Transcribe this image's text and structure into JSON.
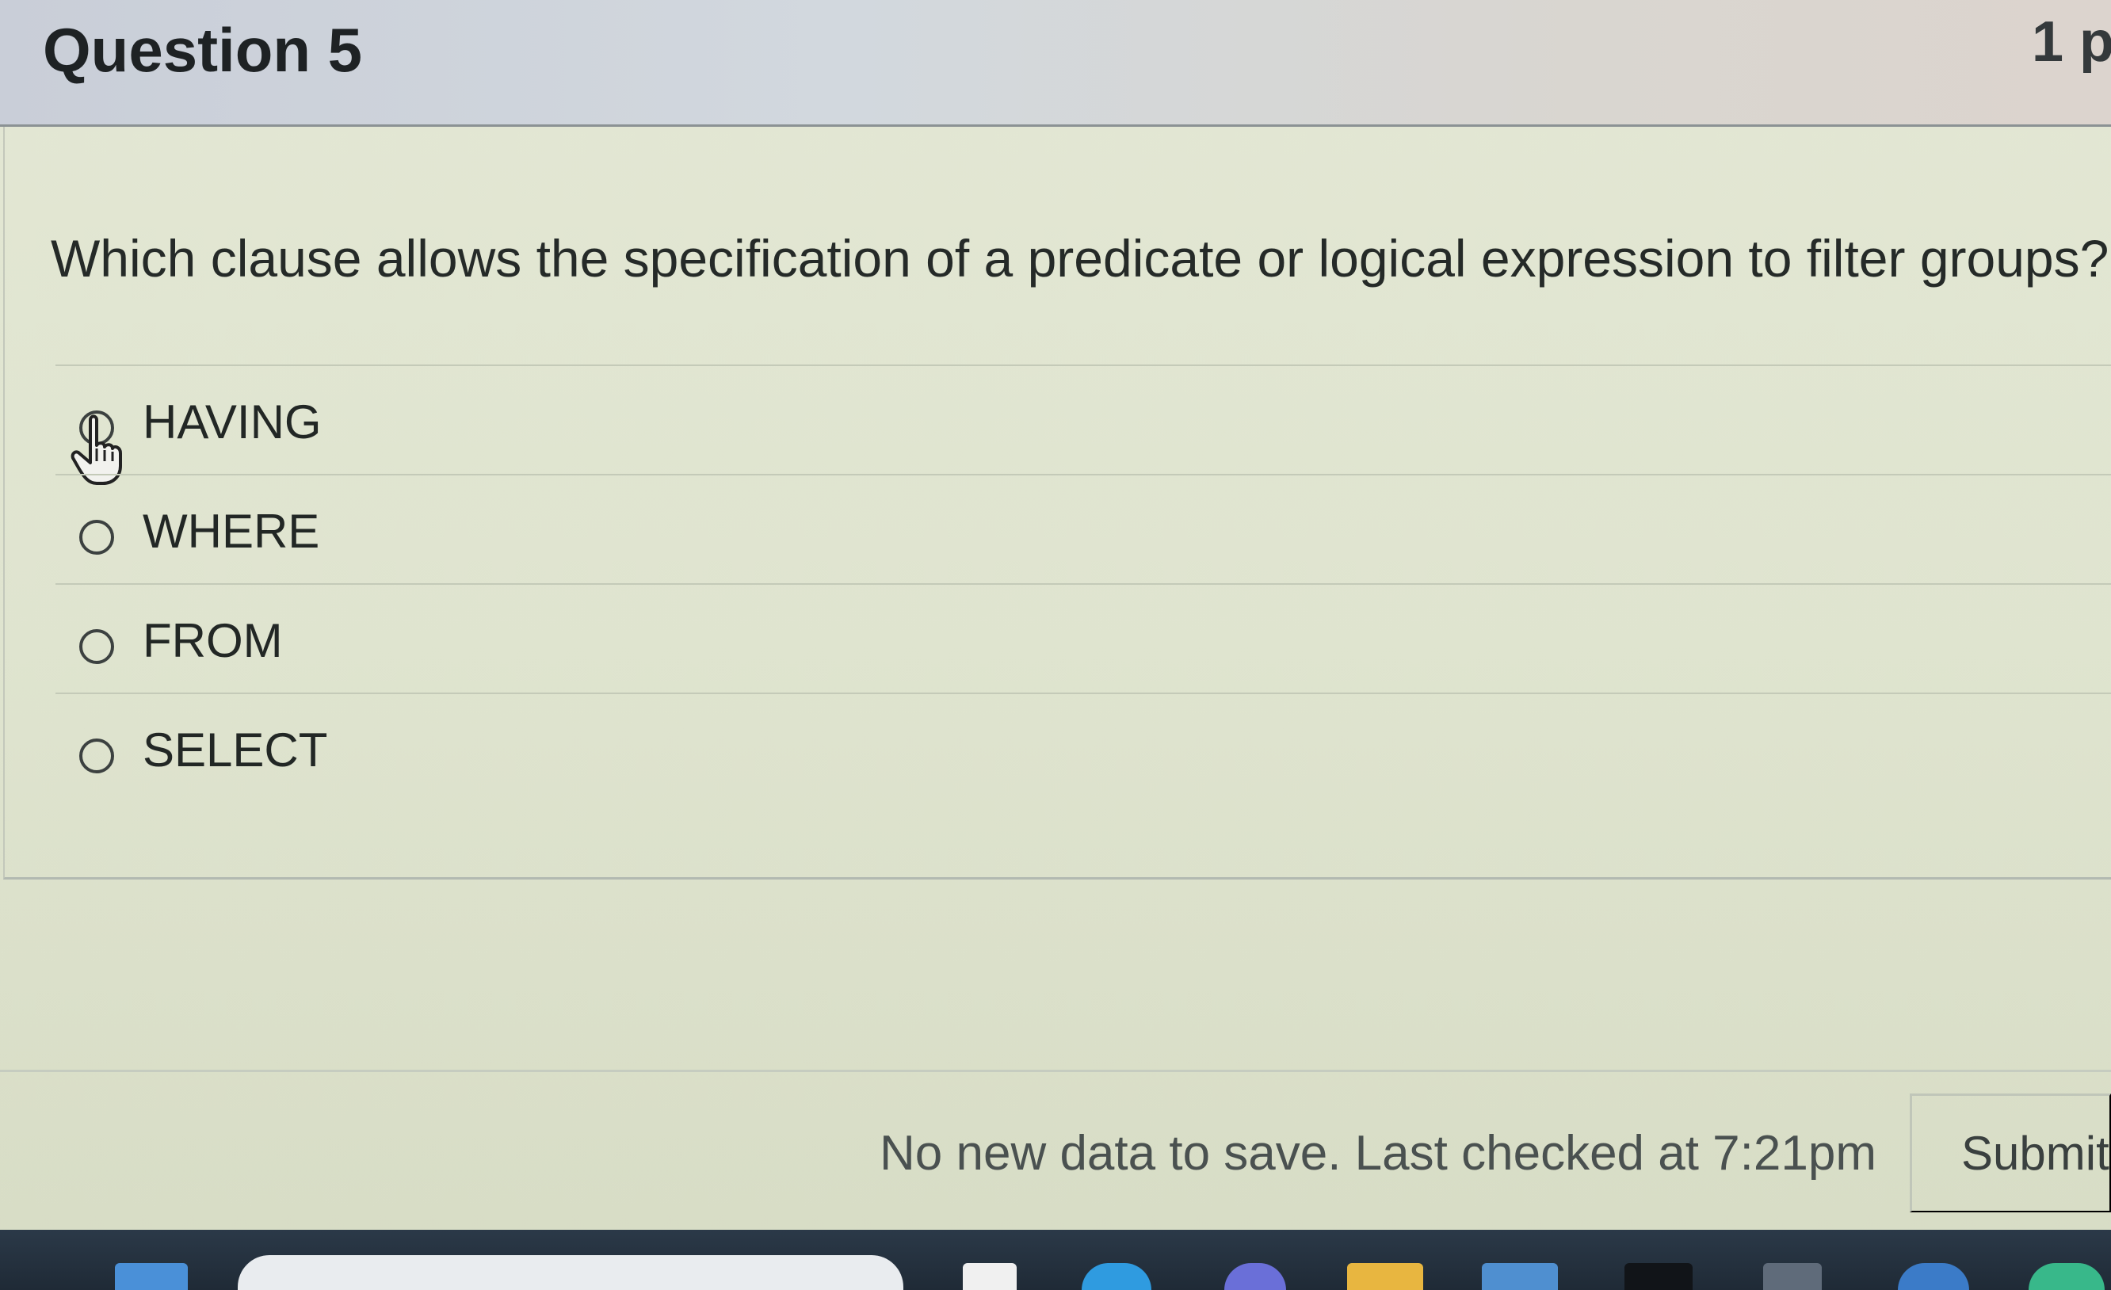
{
  "header": {
    "question_title": "Question 5",
    "points": "1 p"
  },
  "question": {
    "text": "Which clause allows the specification of a predicate or logical expression to filter groups?"
  },
  "answers": [
    {
      "label": "HAVING"
    },
    {
      "label": "WHERE"
    },
    {
      "label": "FROM"
    },
    {
      "label": "SELECT"
    }
  ],
  "footer": {
    "status": "No new data to save. Last checked at 7:21pm",
    "submit_label": "Submit"
  },
  "taskbar": {
    "icons": [
      "start-icon",
      "search-bar",
      "app-icon",
      "edge-icon",
      "teams-icon",
      "folder-icon",
      "store-icon",
      "app-icon",
      "calculator-icon",
      "app-icon",
      "app-icon"
    ]
  }
}
